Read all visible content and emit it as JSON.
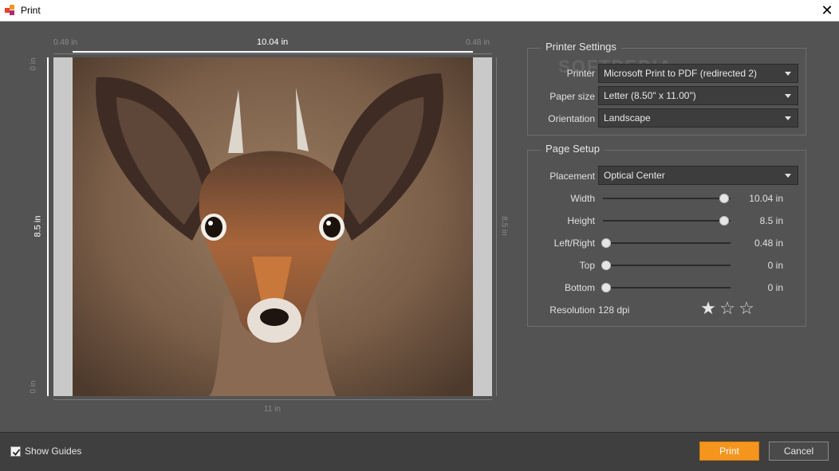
{
  "window": {
    "title": "Print",
    "close_glyph": "✕"
  },
  "preview": {
    "margin_left": "0.48 in",
    "width": "10.04 in",
    "margin_right": "0.48 in",
    "paper_width": "11 in",
    "height_left": "8.5 in",
    "height_right": "8.5 in",
    "top_margin": "0 in",
    "bottom_margin": "0 in",
    "image_description": "dik-dik antelope portrait"
  },
  "watermark": "SOFTPEDIA",
  "printer_settings": {
    "title": "Printer Settings",
    "printer": {
      "label": "Printer",
      "value": "Microsoft Print to PDF (redirected 2)"
    },
    "paper_size": {
      "label": "Paper size",
      "value": "Letter  (8.50\" x 11.00\")"
    },
    "orientation": {
      "label": "Orientation",
      "value": "Landscape"
    }
  },
  "page_setup": {
    "title": "Page Setup",
    "placement": {
      "label": "Placement",
      "value": "Optical Center"
    },
    "sliders": [
      {
        "label": "Width",
        "value": "10.04 in",
        "fraction": 1.0
      },
      {
        "label": "Height",
        "value": "8.5 in",
        "fraction": 1.0
      },
      {
        "label": "Left/Right",
        "value": "0.48 in",
        "fraction": 0.0
      },
      {
        "label": "Top",
        "value": "0 in",
        "fraction": 0.0
      },
      {
        "label": "Bottom",
        "value": "0 in",
        "fraction": 0.0
      }
    ],
    "resolution_label": "Resolution",
    "resolution_value": "128 dpi",
    "rating": 1,
    "rating_max": 3
  },
  "footer": {
    "show_guides_label": "Show Guides",
    "show_guides_checked": true,
    "print_label": "Print",
    "cancel_label": "Cancel"
  },
  "colors": {
    "accent": "#f5951e",
    "background": "#535353",
    "footer": "#3f3f3f"
  }
}
